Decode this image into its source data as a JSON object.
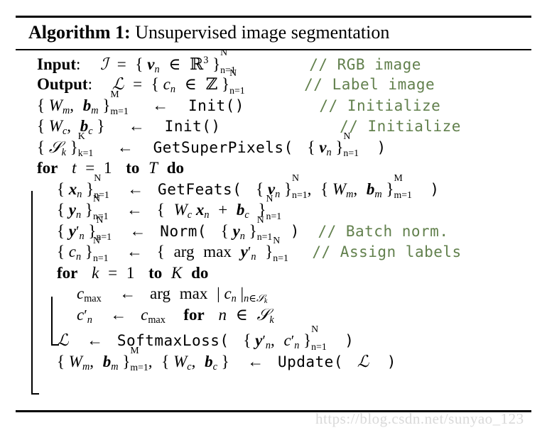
{
  "document": {
    "type": "algorithm-block",
    "title_label": "Algorithm 1:",
    "title_text": "Unsupervised image segmentation",
    "watermark": "https://blog.csdn.net/sunyao_123",
    "comment_color": "#62804d",
    "text_color": "#000000",
    "background_color": "#ffffff",
    "watermark_color": "#d9d9d9"
  },
  "lines": [
    {
      "id": "input",
      "keyword": "Input",
      "math": "I = { v_n ∈ ℝ^3 }_{n=1}^{N}",
      "comment": "// RGB image"
    },
    {
      "id": "output",
      "keyword": "Output",
      "math": "L = { c_n ∈ ℤ }_{n=1}^{N}",
      "comment": "// Label image"
    },
    {
      "id": "init-weights-m",
      "math": "{W_m, b_m}_{m=1}^{M} ← Init()",
      "function": "Init()",
      "comment": "// Initialize"
    },
    {
      "id": "init-weights-c",
      "math": "{W_c, b_c} ← Init()",
      "function": "Init()",
      "comment": "// Initialize"
    },
    {
      "id": "get-superpixels",
      "math": "{S_k}_{k=1}^{K} ← GetSuperPixels( {v_n}_{n=1}^{N} )",
      "function": "GetSuperPixels",
      "comment": ""
    },
    {
      "id": "for-t",
      "keyword_for": "for",
      "math": "t = 1",
      "keyword_to": "to",
      "bound": "T",
      "keyword_do": "do"
    },
    {
      "id": "get-feats",
      "math": "{x_n}_{n=1}^{N} ← GetFeats( {v_n}_{n=1}^{N}, {W_m, b_m}_{m=1}^{M} )",
      "function": "GetFeats",
      "comment": ""
    },
    {
      "id": "linear-response",
      "math": "{y_n}_{n=1}^{N} ← { W_c x_n + b_c }_{n=1}^{N}",
      "comment": ""
    },
    {
      "id": "batch-norm",
      "math": "{y'_n}_{n=1}^{N} ← Norm( {y_n}_{n=1}^{N} )",
      "function": "Norm",
      "comment": "// Batch norm."
    },
    {
      "id": "assign-labels",
      "math": "{c_n}_{n=1}^{N} ← { arg max y'_n }_{n=1}^{N}",
      "comment": "// Assign labels"
    },
    {
      "id": "for-k",
      "keyword_for": "for",
      "math": "k = 1",
      "keyword_to": "to",
      "bound": "K",
      "keyword_do": "do"
    },
    {
      "id": "cmax",
      "math": "c_max ← arg max |c_n|_{n ∈ S_k}",
      "comment": ""
    },
    {
      "id": "cprime",
      "math": "c'_n ← c_max for n ∈ S_k",
      "comment": ""
    },
    {
      "id": "loss",
      "math": "ℒ ← SoftmaxLoss( {y'_n, c'_n}_{n=1}^{N} )",
      "function": "SoftmaxLoss",
      "comment": ""
    },
    {
      "id": "update",
      "math": "{W_m, b_m}_{m=1}^{M}, {W_c, b_c} ← Update( ℒ )",
      "function": "Update",
      "comment": ""
    }
  ],
  "tokens": {
    "input_kw": "Input",
    "output_kw": "Output",
    "colon": ":",
    "for": "for",
    "to": "to",
    "do": "do",
    "arrow": "←",
    "equals": "=",
    "in": "∈",
    "plus": "+",
    "comma": ",",
    "lbrace": "{",
    "rbrace": "}",
    "lparen": "(",
    "rparen": ")",
    "bar": "|",
    "arg": "arg",
    "max": "max",
    "one": "1",
    "three": "3",
    "N": "N",
    "M": "M",
    "K": "K",
    "T": "T",
    "n": "n",
    "m": "m",
    "k": "k",
    "t": "t",
    "n_eq_1": "n=1",
    "m_eq_1": "m=1",
    "k_eq_1": "k=1",
    "I_cal": "ℐ",
    "L_cal": "ℒ",
    "S_cal": "𝒮",
    "R_bb": "ℝ",
    "Z_bb": "ℤ",
    "script_L": "ℒ",
    "v": "v",
    "x": "x",
    "y": "y",
    "c": "c",
    "b": "b",
    "W": "W",
    "max_sub": "max",
    "prime": "′",
    "fn_init": "Init",
    "fn_getsuperpixels": "GetSuperPixels",
    "fn_getfeats": "GetFeats",
    "fn_norm": "Norm",
    "fn_softmaxloss": "SoftmaxLoss",
    "fn_update": "Update"
  },
  "comments": {
    "rgb": "// RGB image",
    "label": "// Label image",
    "init1": "// Initialize",
    "init2": "// Initialize",
    "batchnorm": "// Batch norm.",
    "assign": "// Assign labels"
  }
}
